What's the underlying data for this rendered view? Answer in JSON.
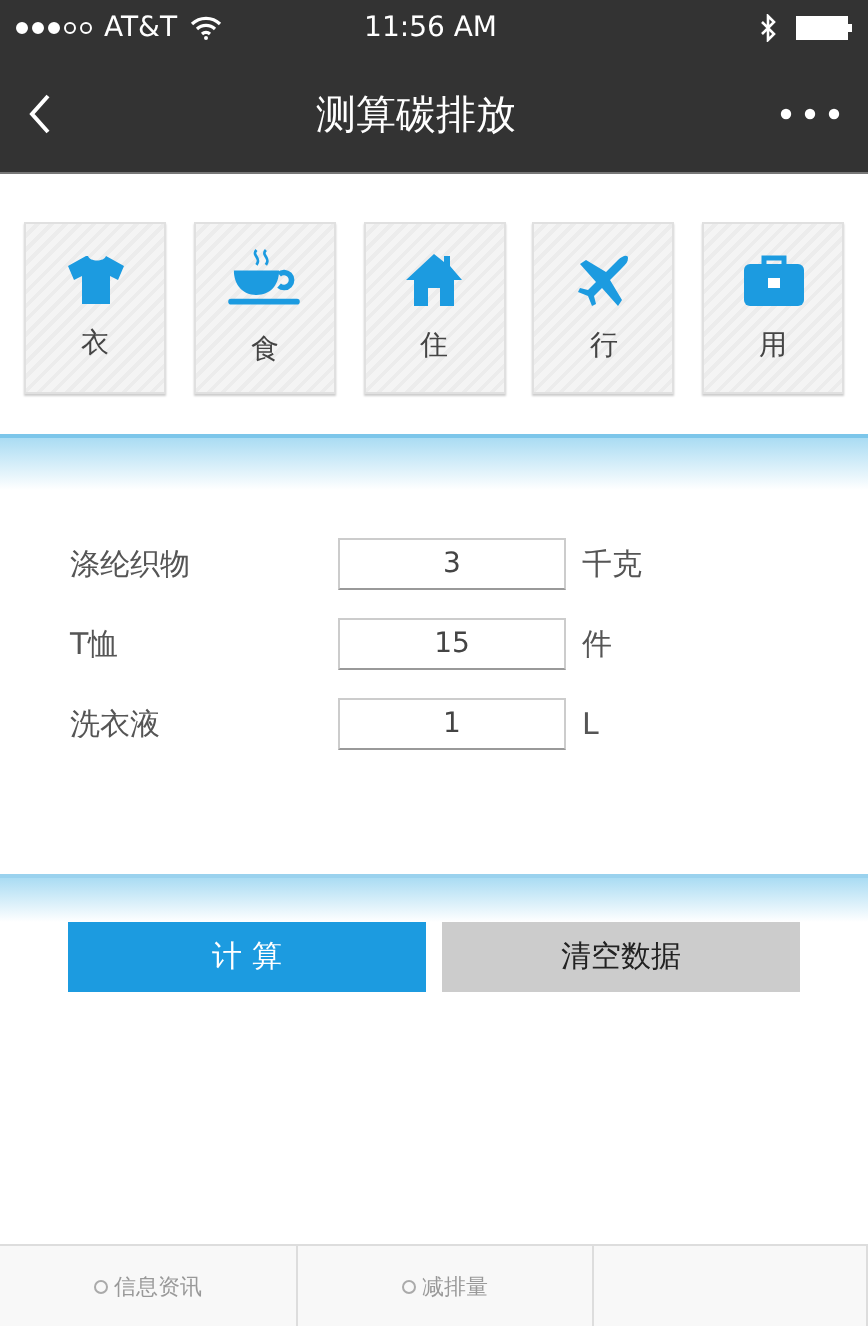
{
  "status_bar": {
    "carrier": "AT&T",
    "time": "11:56 AM"
  },
  "nav_bar": {
    "title": "测算碳排放"
  },
  "categories": [
    {
      "label": "衣",
      "kind": "shirt"
    },
    {
      "label": "食",
      "kind": "cup"
    },
    {
      "label": "住",
      "kind": "house"
    },
    {
      "label": "行",
      "kind": "plane"
    },
    {
      "label": "用",
      "kind": "briefcase"
    }
  ],
  "fields": [
    {
      "label": "涤纶织物",
      "value": "3",
      "unit": "千克"
    },
    {
      "label": "T恤",
      "value": "15",
      "unit": "件"
    },
    {
      "label": "洗衣液",
      "value": "1",
      "unit": "L"
    }
  ],
  "buttons": [
    {
      "label": "计 算",
      "kind": "primary"
    },
    {
      "label": "清空数据",
      "kind": "secondary"
    }
  ],
  "tab_bar": [
    {
      "label": "信息资讯"
    },
    {
      "label": "减排量"
    }
  ]
}
